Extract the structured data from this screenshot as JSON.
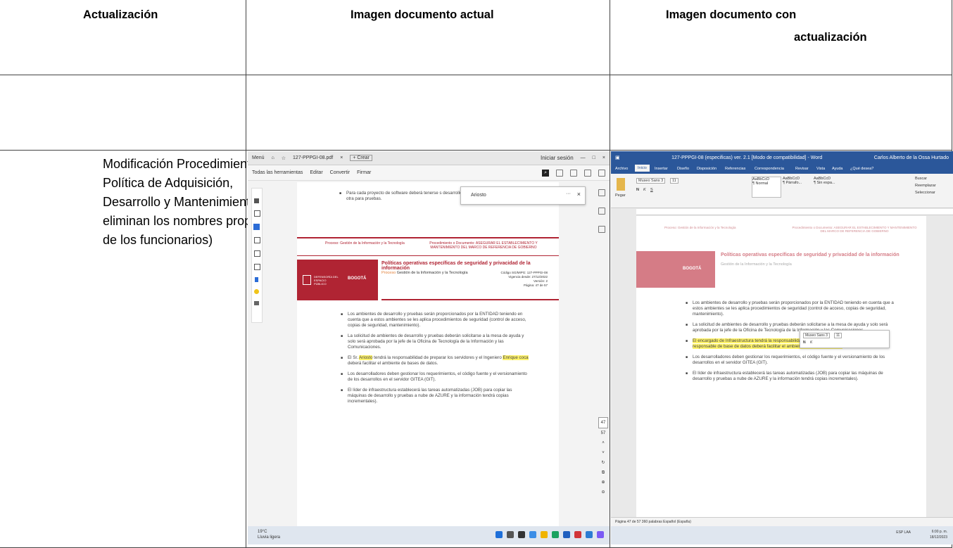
{
  "headers": {
    "col1": "Actualización",
    "col2": "Imagen documento actual",
    "col3_line1": "Imagen documento con",
    "col3_line2": "actualización"
  },
  "row_description": {
    "lines": [
      "Modificación Procedimiento de",
      "Política de Adquisición,",
      "Desarrollo y Mantenimiento (se",
      "eliminan los nombres propios",
      "de los funcionarios)"
    ]
  },
  "pdf_viewer": {
    "menu": "Menú",
    "tab_title": "127-PPPGI-08.pdf",
    "new_tab": "+ Crear",
    "sign_in": "Iniciar sesión",
    "toolbar": [
      "Todas las herramientas",
      "Editar",
      "Convertir",
      "Firmar"
    ],
    "search_value": "Ariosto",
    "top_bullet": "Para cada proyecto de software deberá tenerse s desarrollo y otra para pruebas.",
    "header_process": "Proceso: Gestión de la Información y la Tecnología",
    "header_procedure": "Procedimiento o Documento: ASEGURAR EL ESTABLECIMIENTO Y MANTENIMIENTO DEL MARCO DE REFERENCIA DE GOBIERNO",
    "doc_title": "Políticas operativas específicas de seguridad y privacidad de la información",
    "process_label": "Proceso",
    "process_name": "Gestión de la Información y la Tecnología",
    "code": "Código SG/MIPG: 127-PPPGI-08",
    "valid_from": "Vigencia desde: 27/12/2022",
    "version": "Versión: 2",
    "page": "Página: 47 de 57",
    "logo_left": "DEFENSORÍA DEL ESPACIO PÚBLICO",
    "logo_right": "BOGOTÁ",
    "bullets": [
      "Los ambientes de desarrollo y pruebas serán proporcionados por la ENTIDAD teniendo en cuenta que a estos ambientes se les aplica procedimientos de seguridad (control de acceso, copias de seguridad, mantenimiento).",
      "La solicitud de ambientes de desarrollo y pruebas deberán solicitarse a la mesa de ayuda y solo será aprobada por la jefe de la Oficina de Tecnología de la Información y las Comunicaciones.",
      "El Sr. ",
      "Los desarrolladores deben gestionar los requerimientos, el código fuente y el versionamiento de los desarrollos en el servidor GITEA (GIT).",
      "El líder de infraestructura establecerá las tareas automatizadas (JOB) para copiar las máquinas de desarrollo y pruebas a nube de AZURE y la información tendrá copias incrementales)."
    ],
    "bullet3_name": "Ariosto",
    "bullet3_mid": " tendrá la responsabilidad de preparar los servidores y el Ingeniero ",
    "bullet3_name2": "Enrique coca",
    "bullet3_end": " deberá facilitar el ambiente de bases de datos.",
    "page_num": "47",
    "page_total": "57"
  },
  "word": {
    "title": "127-PPPGI-08 (especificas) ver. 2.1 [Modo de compatibilidad] - Word",
    "user": "Carlos Alberto de la Ossa Hurtado",
    "ribbon_tabs": [
      "Archivo",
      "Inicio",
      "Insertar",
      "Diseño",
      "Disposición",
      "Referencias",
      "Correspondencia",
      "Revisar",
      "Vista",
      "Ayuda",
      "¿Qué desea?"
    ],
    "font_name": "Museo Sans 3",
    "font_size": "11",
    "styles": [
      "AaBbCcD",
      "AaBbCcD",
      "AaBbCcD"
    ],
    "style_names": [
      "¶ Normal",
      "¶ Párrafo...",
      "¶ Sin espa..."
    ],
    "search": "Buscar",
    "replace": "Reemplazar",
    "select": "Seleccionar",
    "paste": "Pegar",
    "header_process": "Proceso: Gestión de la Información y la Tecnología",
    "header_procedure": "Procedimiento o Documento: ASEGURAR EL ESTABLECIMIENTO Y MANTENIMIENTO DEL MARCO DE REFERENCIA DE GOBIERNO",
    "bullet3_new": "El encargado de Infraestructura tendrá la responsabilidad de preparar los servidores y el ingeniero responsable de base de datos deberá facilitar el ambiente de bases de datos.",
    "status": "Página 47 de 57    360 palabras    Español (España)"
  },
  "taskbar": {
    "weather_temp": "19°C",
    "weather_desc": "Lluvia ligera",
    "time": "6:00 p. m.",
    "date": "18/12/2023",
    "lang": "ESP LAA"
  }
}
